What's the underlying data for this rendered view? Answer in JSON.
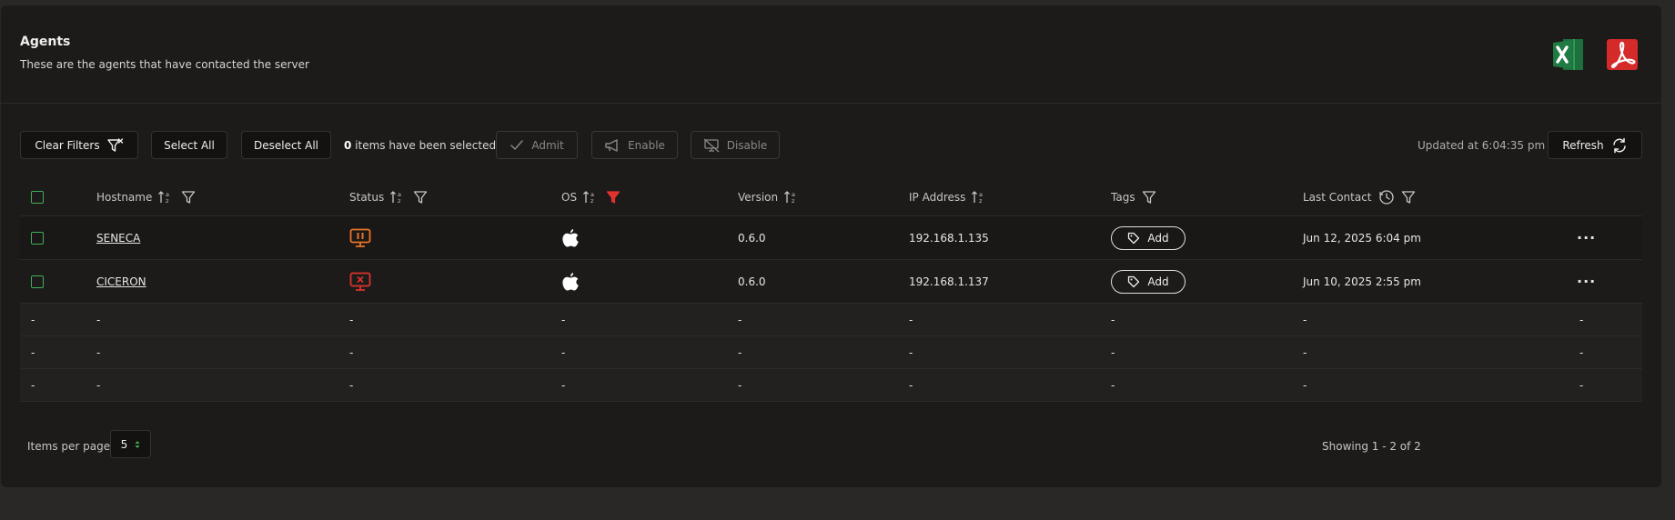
{
  "header": {
    "title": "Agents",
    "subtitle": "These are the agents that have contacted the server"
  },
  "toolbar": {
    "clear_filters": "Clear Filters",
    "select_all": "Select All",
    "deselect_all": "Deselect All",
    "selected_count": "0",
    "selected_text": " items have been selected",
    "admit": "Admit",
    "enable": "Enable",
    "disable": "Disable",
    "updated": "Updated at 6:04:35 pm",
    "refresh": "Refresh"
  },
  "columns": {
    "hostname": "Hostname",
    "status": "Status",
    "os": "OS",
    "version": "Version",
    "ip": "IP Address",
    "tags": "Tags",
    "last_contact": "Last Contact"
  },
  "rows": [
    {
      "hostname": "SENECA",
      "status": "paused",
      "status_color": "#e8742c",
      "os": "apple-icon",
      "version": "0.6.0",
      "ip": "192.168.1.135",
      "tag_label": "Add",
      "last_contact": "Jun 12, 2025 6:04 pm"
    },
    {
      "hostname": "CICERON",
      "status": "disconnected",
      "status_color": "#d9332f",
      "os": "apple-icon",
      "version": "0.6.0",
      "ip": "192.168.1.137",
      "tag_label": "Add",
      "last_contact": "Jun 10, 2025 2:55 pm"
    }
  ],
  "empty_placeholder": "-",
  "footer": {
    "items_per_page_label": "Items per page",
    "items_per_page_value": "5",
    "showing": "Showing 1 - 2 of 2"
  },
  "colors": {
    "accent_green": "#3fae5a",
    "excel_green": "#1d6f3c",
    "pdf_red": "#d42a2a",
    "filter_active": "#e0332f"
  }
}
